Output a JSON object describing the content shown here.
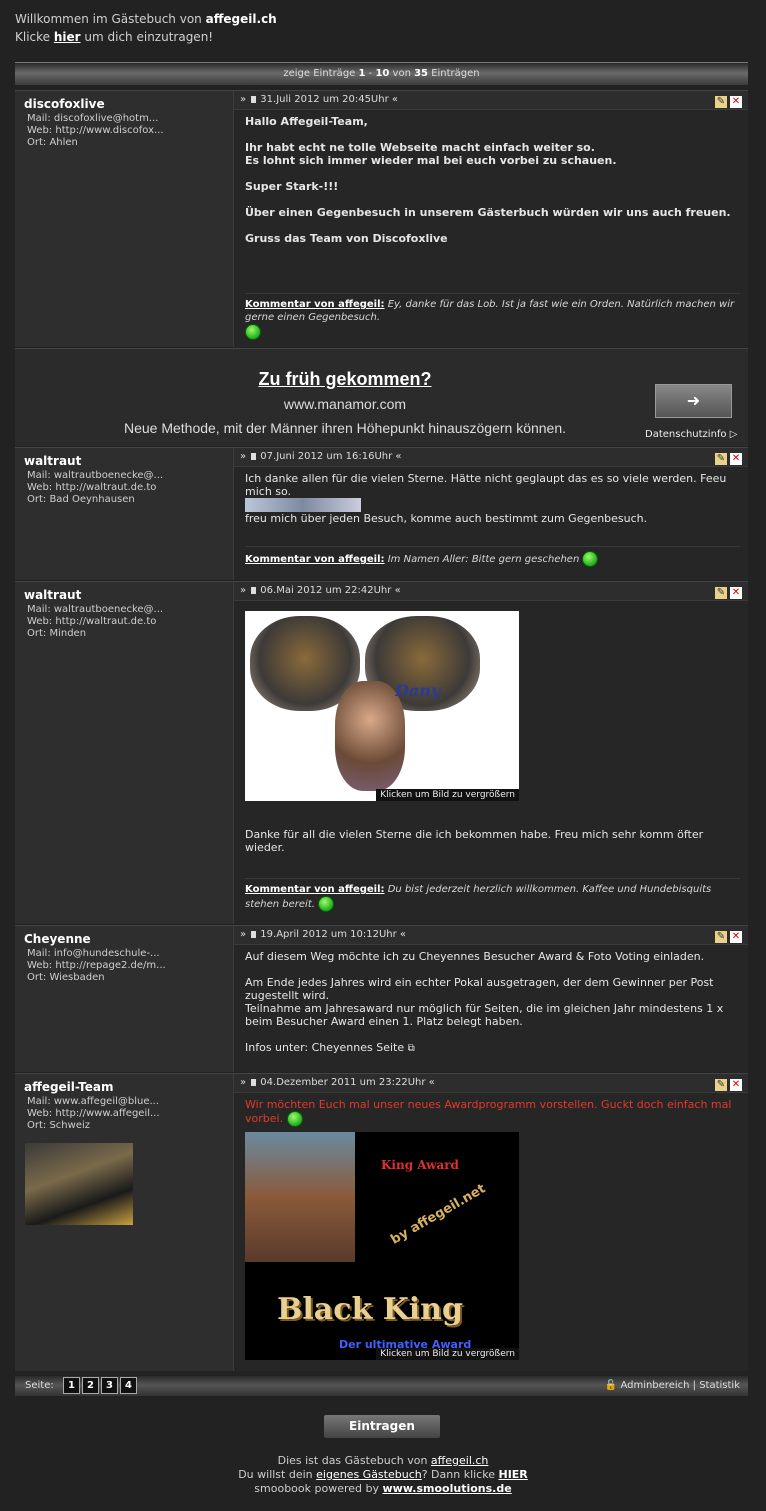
{
  "welcome": {
    "prefix": "Willkommen im Gästebuch von ",
    "site": "affegeil.ch",
    "line2_pre": "Klicke ",
    "line2_link": "hier",
    "line2_post": " um dich einzutragen!"
  },
  "topbar": {
    "pre": "zeige Einträge ",
    "from": "1",
    "dash": " - ",
    "to": "10",
    "von": " von ",
    "total": "35",
    "post": " Einträgen"
  },
  "entries": [
    {
      "author": "discofoxlive",
      "mail": "Mail: discofoxlive@hotm...",
      "web": "Web: http://www.discofox...",
      "ort": "Ort: Ahlen",
      "date": "31.Juli 2012 um 20:45Uhr «",
      "lines": [
        "Hallo Affegeil-Team,",
        "Ihr habt echt ne tolle Webseite macht einfach weiter so.",
        "Es lohnt sich immer wieder mal bei euch vorbei zu schauen.",
        "Super Stark-!!!",
        "Über einen Gegenbesuch in unserem Gästerbuch würden wir uns auch freuen.",
        "Gruss das Team von Discofoxlive"
      ],
      "comment_label": "Kommentar von affegeil:",
      "comment": " Ey, danke für das Lob. Ist ja fast wie ein Orden. Natürlich machen wir gerne einen Gegenbesuch."
    },
    {
      "author": "waltraut",
      "mail": "Mail: waltrautboenecke@...",
      "web": "Web: http://waltraut.de.to",
      "ort": "Ort: Bad Oeynhausen",
      "date": "07.Juni 2012 um 16:16Uhr «",
      "lines": [
        "Ich danke allen für die vielen Sterne. Hätte nicht geglaupt das es so viele werden. Feeu mich so.",
        "freu mich über jeden Besuch, komme auch bestimmt zum Gegenbesuch."
      ],
      "comment_label": "Kommentar von affegeil:",
      "comment": " Im Namen Aller: Bitte gern geschehen"
    },
    {
      "author": "waltraut",
      "mail": "Mail: waltrautboenecke@...",
      "web": "Web: http://waltraut.de.to",
      "ort": "Ort: Minden",
      "date": "06.Mai 2012 um 22:42Uhr «",
      "photo_text": "Dany",
      "caption": "Klicken um Bild zu vergrößern",
      "lines": [
        "Danke für all die vielen Sterne die ich bekommen habe. Freu mich sehr komm öfter wieder."
      ],
      "comment_label": "Kommentar von affegeil:",
      "comment": " Du bist jederzeit herzlich willkommen. Kaffee und Hundebisquits stehen bereit."
    },
    {
      "author": "Cheyenne",
      "mail": "Mail: info@hundeschule-...",
      "web": "Web: http://repage2.de/m...",
      "ort": "Ort: Wiesbaden",
      "date": "19.April 2012 um 10:12Uhr «",
      "lines": [
        "Auf diesem Weg möchte ich zu Cheyennes Besucher Award & Foto Voting einladen.",
        "Am Ende jedes Jahres wird ein echter Pokal ausgetragen, der dem Gewinner per Post zugestellt wird.",
        "Teilnahme am Jahresaward nur möglich für Seiten, die im gleichen Jahr mindestens 1 x beim Besucher Award einen 1. Platz belegt haben.",
        "Infos unter: Cheyennes Seite"
      ]
    },
    {
      "author": "affegeil-Team",
      "mail": "Mail: www.affegeil@blue...",
      "web": "Web: http://www.affegeil...",
      "ort": "Ort: Schweiz",
      "date": "04.Dezember 2011 um 23:22Uhr «",
      "red": "Wir möchten Euch mal unser neues Awardprogramm vorstellen. Guckt doch einfach mal vorbei.",
      "award_title": "King Award",
      "award_by": "by affegeil.net",
      "award_main": "Black King",
      "award_sub": "Der ultimative Award",
      "caption": "Klicken um Bild zu vergrößern"
    }
  ],
  "ad": {
    "headline": "Zu früh gekommen?",
    "domain": "www.manamor.com",
    "text": "Neue Methode, mit der Männer ihren Höhepunkt hinauszögern können.",
    "privacy": "Datenschutzinfo ▷",
    "arrow": "➜"
  },
  "bottom": {
    "seite": "Seite:",
    "pages": [
      "1",
      "2",
      "3",
      "4"
    ],
    "admin": "Adminbereich",
    "sep": " | ",
    "stat": "Statistik"
  },
  "button": "Eintragen",
  "footer": {
    "l1_pre": "Dies ist das Gästebuch von ",
    "l1_link": "affegeil.ch",
    "l2_pre": "Du willst dein ",
    "l2_link": "eigenes Gästebuch",
    "l2_mid": "? Dann klicke ",
    "l2_here": "HIER",
    "l3_pre": "smoobook powered by ",
    "l3_link": "www.smoolutions.de"
  },
  "colors": {
    "red": "#e23a2a",
    "bg": "#222222"
  }
}
